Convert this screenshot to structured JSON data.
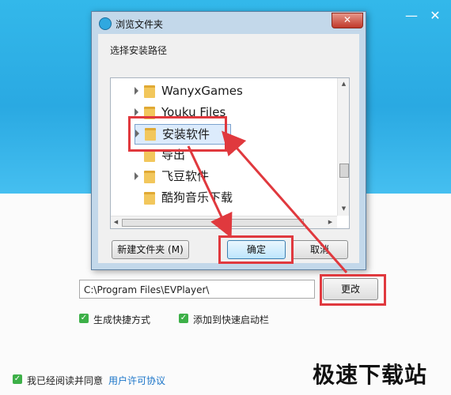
{
  "dialog": {
    "title": "浏览文件夹",
    "instruction": "选择安装路径",
    "close_label": "✕",
    "tree_items": [
      {
        "label": "WanyxGames",
        "has_children": true
      },
      {
        "label": "Youku Files",
        "has_children": true
      },
      {
        "label": "安装软件",
        "has_children": true,
        "selected": true
      },
      {
        "label": "导出",
        "has_children": false
      },
      {
        "label": "飞豆软件",
        "has_children": true
      },
      {
        "label": "酷狗音乐下载",
        "has_children": false
      }
    ],
    "new_folder_label": "新建文件夹 (M)",
    "ok_label": "确定",
    "cancel_label": "取消"
  },
  "installer": {
    "minimize_label": "—",
    "close_label": "✕",
    "path_value": "C:\\Program Files\\EVPlayer\\",
    "change_label": "更改",
    "options": [
      {
        "label": "生成快捷方式",
        "checked": true
      },
      {
        "label": "添加到快速启动栏",
        "checked": true
      }
    ],
    "agree_label": "我已经阅读并同意",
    "license_link": "用户许可协议"
  },
  "watermark": "极速下载站",
  "colors": {
    "highlight_red": "#e0393e",
    "check_green": "#3db048",
    "link_blue": "#1a74c8",
    "installer_blue": "#33b8ea"
  }
}
